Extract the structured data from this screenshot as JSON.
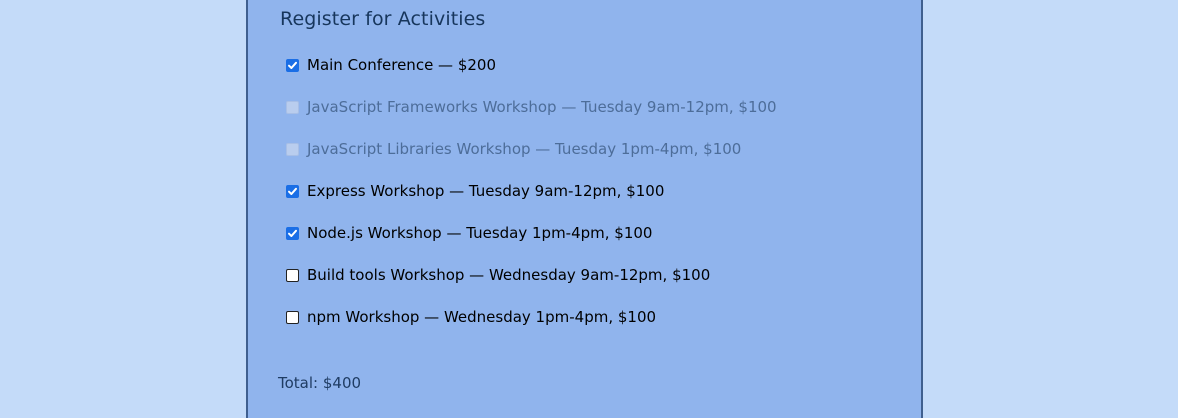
{
  "form": {
    "title": "Register for Activities",
    "activities": [
      {
        "label": "Main Conference — $200",
        "checked": true,
        "disabled": false
      },
      {
        "label": "JavaScript Frameworks Workshop — Tuesday 9am-12pm, $100",
        "checked": false,
        "disabled": true
      },
      {
        "label": "JavaScript Libraries Workshop — Tuesday 1pm-4pm, $100",
        "checked": false,
        "disabled": true
      },
      {
        "label": "Express Workshop — Tuesday 9am-12pm, $100",
        "checked": true,
        "disabled": false
      },
      {
        "label": "Node.js Workshop — Tuesday 1pm-4pm, $100",
        "checked": true,
        "disabled": false
      },
      {
        "label": "Build tools Workshop — Wednesday 9am-12pm, $100",
        "checked": false,
        "disabled": false
      },
      {
        "label": "npm Workshop — Wednesday 1pm-4pm, $100",
        "checked": false,
        "disabled": false
      }
    ],
    "total": "Total: $400"
  },
  "colors": {
    "page_background": "#c4dbf9",
    "panel_background": "#90b4ed",
    "panel_border": "#3f5f8f",
    "checkbox_accent": "#1a6ee6"
  }
}
